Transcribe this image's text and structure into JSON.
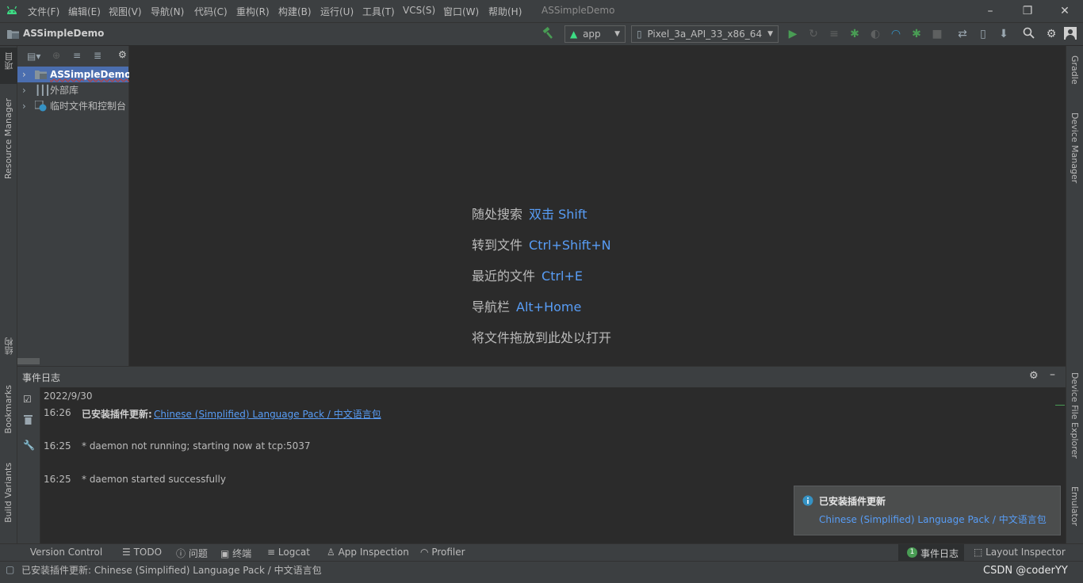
{
  "window": {
    "title": "ASSimpleDemo",
    "menu": [
      "文件(F)",
      "编辑(E)",
      "视图(V)",
      "导航(N)",
      "代码(C)",
      "重构(R)",
      "构建(B)",
      "运行(U)",
      "工具(T)",
      "VCS(S)",
      "窗口(W)",
      "帮助(H)"
    ]
  },
  "navbar": {
    "project_name": "ASSimpleDemo",
    "run_config": "app",
    "device": "Pixel_3a_API_33_x86_64"
  },
  "left_stripe": {
    "project_tab": "项目",
    "resource_manager": "Resource Manager",
    "structure": "结构",
    "bookmarks": "Bookmarks",
    "build_variants": "Build Variants"
  },
  "right_stripe": {
    "gradle": "Gradle",
    "device_manager": "Device Manager",
    "device_file_explorer": "Device File Explorer",
    "emulator": "Emulator"
  },
  "project_tree": [
    {
      "label": "ASSimpleDemo"
    },
    {
      "label": "外部库"
    },
    {
      "label": "临时文件和控制台"
    }
  ],
  "editor_hints": [
    {
      "text": "随处搜索",
      "shortcut": "双击 Shift"
    },
    {
      "text": "转到文件",
      "shortcut": "Ctrl+Shift+N"
    },
    {
      "text": "最近的文件",
      "shortcut": "Ctrl+E"
    },
    {
      "text": "导航栏",
      "shortcut": "Alt+Home"
    },
    {
      "text": "将文件拖放到此处以打开",
      "shortcut": ""
    }
  ],
  "event_log": {
    "title": "事件日志",
    "date": "2022/9/30",
    "entries": [
      {
        "time": "16:26",
        "prefix": "已安装插件更新:",
        "link": "Chinese (Simplified) Language Pack / 中文语言包",
        "text": ""
      },
      {
        "time": "16:25",
        "prefix": "",
        "link": "",
        "text": "* daemon not running; starting now at tcp:5037"
      },
      {
        "time": "16:25",
        "prefix": "",
        "link": "",
        "text": "* daemon started successfully"
      }
    ]
  },
  "notification": {
    "title": "已安装插件更新",
    "link": "Chinese (Simplified) Language Pack / 中文语言包"
  },
  "bottom_tabs": {
    "version_control": "Version Control",
    "todo": "TODO",
    "problems": "问题",
    "terminal": "终端",
    "logcat": "Logcat",
    "app_inspection": "App Inspection",
    "profiler": "Profiler",
    "event_log": "事件日志",
    "event_log_count": "1",
    "layout_inspector": "Layout Inspector"
  },
  "status_bar": {
    "message": "已安装插件更新: Chinese (Simplified) Language Pack / 中文语言包",
    "watermark": "CSDN @coderYY"
  },
  "colors": {
    "accent_link": "#589df6",
    "run_green": "#499c54",
    "android_green": "#3ddc84",
    "selection": "#4b6eaf"
  }
}
